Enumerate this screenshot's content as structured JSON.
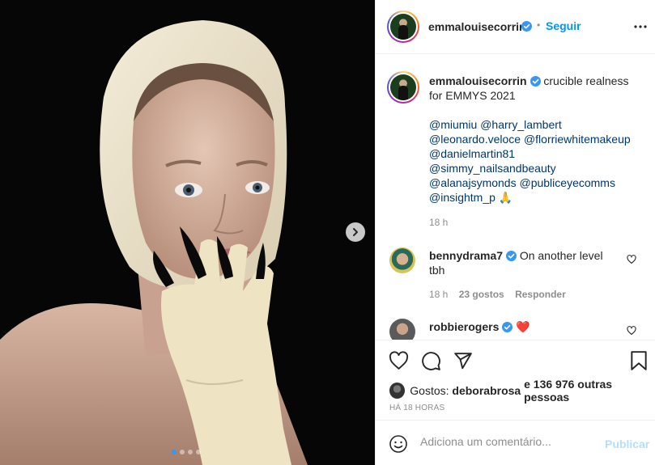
{
  "post": {
    "author": "emmalouisecorrin",
    "follow_label": "Seguir",
    "separator": "•",
    "more_icon": "more-horizontal-icon",
    "caption_line1": "crucible realness",
    "caption_line2": "for EMMYS 2021",
    "mentions": [
      "@miumiu @harry_lambert",
      "@leonardo.veloce @florriewhitemakeup",
      "@danielmartin81",
      "@simmy_nailsandbeauty",
      "@alanajsymonds @publiceyecomms",
      "@insightm_p"
    ],
    "emoji": "🙏",
    "caption_time": "18 h",
    "carousel": {
      "slides": 4,
      "active": 1
    }
  },
  "comments": [
    {
      "user": "bennydrama7",
      "text_line1": "On another level",
      "text_line2": "tbh",
      "time": "18 h",
      "likes": "23 gostos",
      "reply": "Responder"
    },
    {
      "user": "robbierogers",
      "emoji": "❤️"
    }
  ],
  "likes": {
    "prefix": "Gostos:",
    "first_user": "deborabrosa",
    "rest": "e 136 976 outras pessoas"
  },
  "posted_ago": "HÁ 18 HORAS",
  "composer": {
    "placeholder": "Adiciona um comentário...",
    "publish_label": "Publicar"
  },
  "colors": {
    "accent": "#0095f6",
    "verified": "#3897f0",
    "mention": "#00376b",
    "publish_disabled": "#b2dffc"
  }
}
